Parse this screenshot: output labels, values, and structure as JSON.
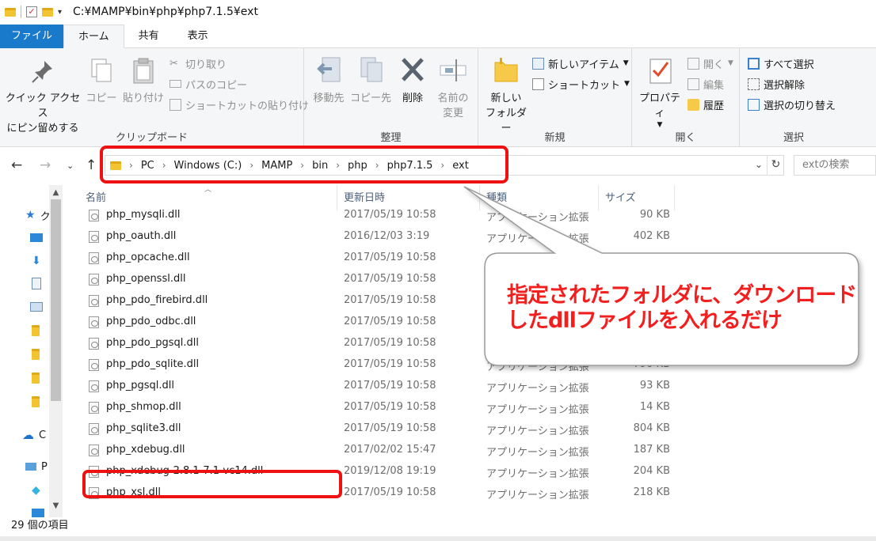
{
  "window": {
    "title_path": "C:¥MAMP¥bin¥php¥php7.1.5¥ext"
  },
  "tabs": [
    {
      "label": "ファイル"
    },
    {
      "label": "ホーム"
    },
    {
      "label": "共有"
    },
    {
      "label": "表示"
    }
  ],
  "ribbon": {
    "clipboard": {
      "label": "クリップボード",
      "pin_line1": "クイック アクセス",
      "pin_line2": "にピン留めする",
      "copy": "コピー",
      "paste": "貼り付け",
      "cut": "切り取り",
      "copy_path": "パスのコピー",
      "paste_shortcut": "ショートカットの貼り付け"
    },
    "organize": {
      "label": "整理",
      "move_to": "移動先",
      "copy_to": "コピー先",
      "delete": "削除",
      "rename_line1": "名前の",
      "rename_line2": "変更"
    },
    "new": {
      "label": "新規",
      "new_folder_line1": "新しい",
      "new_folder_line2": "フォルダー",
      "new_item": "新しいアイテム",
      "shortcut": "ショートカット"
    },
    "open": {
      "label": "開く",
      "properties": "プロパティ",
      "open": "開く",
      "edit": "編集",
      "history": "履歴"
    },
    "select": {
      "label": "選択",
      "select_all": "すべて選択",
      "select_none": "選択解除",
      "invert": "選択の切り替え"
    }
  },
  "address": {
    "crumbs": [
      "PC",
      "Windows (C:)",
      "MAMP",
      "bin",
      "php",
      "php7.1.5",
      "ext"
    ],
    "search_placeholder": "extの検索"
  },
  "nav_pane": {
    "quick_access_initial": "ク",
    "onedrive_initial": "C",
    "pc_initial": "P"
  },
  "columns": {
    "name": "名前",
    "modified": "更新日時",
    "type": "種類",
    "size": "サイズ"
  },
  "files": [
    {
      "name": "php_mysqli.dll",
      "modified": "2017/05/19 10:58",
      "type": "アプリケーション拡張",
      "size": "90 KB"
    },
    {
      "name": "php_oauth.dll",
      "modified": "2016/12/03 3:19",
      "type": "アプリケーション拡張",
      "size": "402 KB"
    },
    {
      "name": "php_opcache.dll",
      "modified": "2017/05/19 10:58",
      "type": "",
      "size": ""
    },
    {
      "name": "php_openssl.dll",
      "modified": "2017/05/19 10:58",
      "type": "",
      "size": ""
    },
    {
      "name": "php_pdo_firebird.dll",
      "modified": "2017/05/19 10:58",
      "type": "",
      "size": ""
    },
    {
      "name": "php_pdo_odbc.dll",
      "modified": "2017/05/19 10:58",
      "type": "",
      "size": ""
    },
    {
      "name": "php_pdo_pgsql.dll",
      "modified": "2017/05/19 10:58",
      "type": "",
      "size": ""
    },
    {
      "name": "php_pdo_sqlite.dll",
      "modified": "2017/05/19 10:58",
      "type": "アプリケーション拡張",
      "size": "790 KB"
    },
    {
      "name": "php_pgsql.dll",
      "modified": "2017/05/19 10:58",
      "type": "アプリケーション拡張",
      "size": "93 KB"
    },
    {
      "name": "php_shmop.dll",
      "modified": "2017/05/19 10:58",
      "type": "アプリケーション拡張",
      "size": "14 KB"
    },
    {
      "name": "php_sqlite3.dll",
      "modified": "2017/05/19 10:58",
      "type": "アプリケーション拡張",
      "size": "804 KB"
    },
    {
      "name": "php_xdebug.dll",
      "modified": "2017/02/02 15:47",
      "type": "アプリケーション拡張",
      "size": "187 KB"
    },
    {
      "name": "php_xdebug-2.8.1-7.1-vc14.dll",
      "modified": "2019/12/08 19:19",
      "type": "アプリケーション拡張",
      "size": "204 KB"
    },
    {
      "name": "php_xsl.dll",
      "modified": "2017/05/19 10:58",
      "type": "アプリケーション拡張",
      "size": "218 KB"
    }
  ],
  "status": {
    "item_count": "29 個の項目"
  },
  "annotation": {
    "line1": "指定されたフォルダに、ダウンロード",
    "line2": "したdllファイルを入れるだけ",
    "highlight_color": "#ee1111"
  },
  "colors": {
    "file_tab": "#1979ca",
    "header_text": "#4c607a",
    "callout_text": "#f21f1f"
  }
}
